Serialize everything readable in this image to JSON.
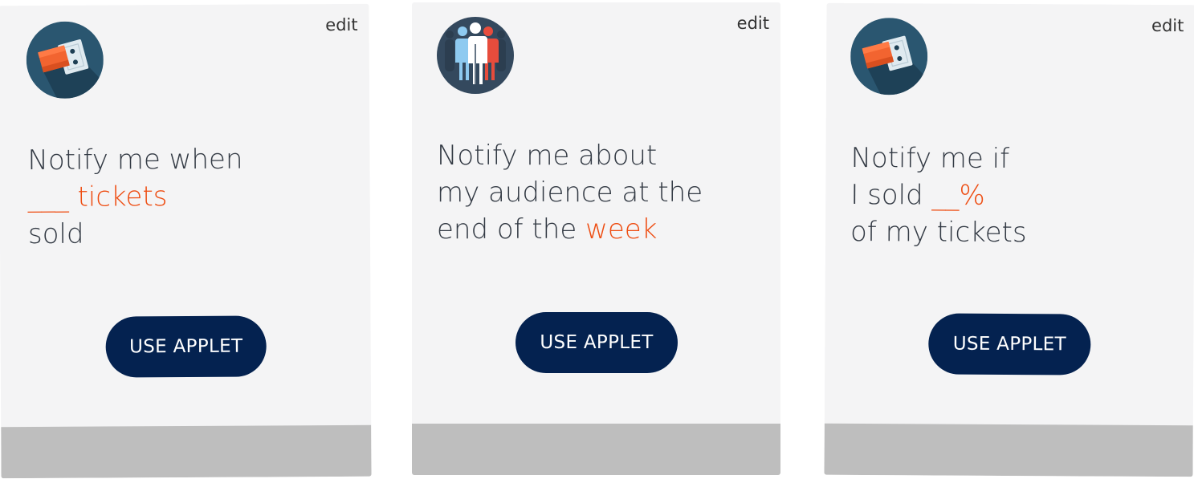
{
  "cards": [
    {
      "edit_label": "edit",
      "icon": "tickets-icon",
      "line1": "Notify me when",
      "line2_highlight": "___ tickets",
      "line3": "sold",
      "button_label": "USE APPLET"
    },
    {
      "edit_label": "edit",
      "icon": "audience-icon",
      "line1": "Notify me about",
      "line2": "my audience at the",
      "line3_prefix": "end of the ",
      "line3_highlight": "week",
      "button_label": "USE APPLET"
    },
    {
      "edit_label": "edit",
      "icon": "tickets-icon",
      "line1": "Notify me if",
      "line2_prefix": "I sold ",
      "line2_highlight": "__%",
      "line3": "of my tickets",
      "button_label": "USE APPLET"
    }
  ],
  "colors": {
    "card_bg": "#f4f4f5",
    "footer_bg": "#bebebe",
    "button_bg": "#042250",
    "highlight": "#ee4d12",
    "text": "#333a44",
    "icon_bg_tickets": "#2a5670",
    "icon_bg_audience": "#34495e"
  }
}
